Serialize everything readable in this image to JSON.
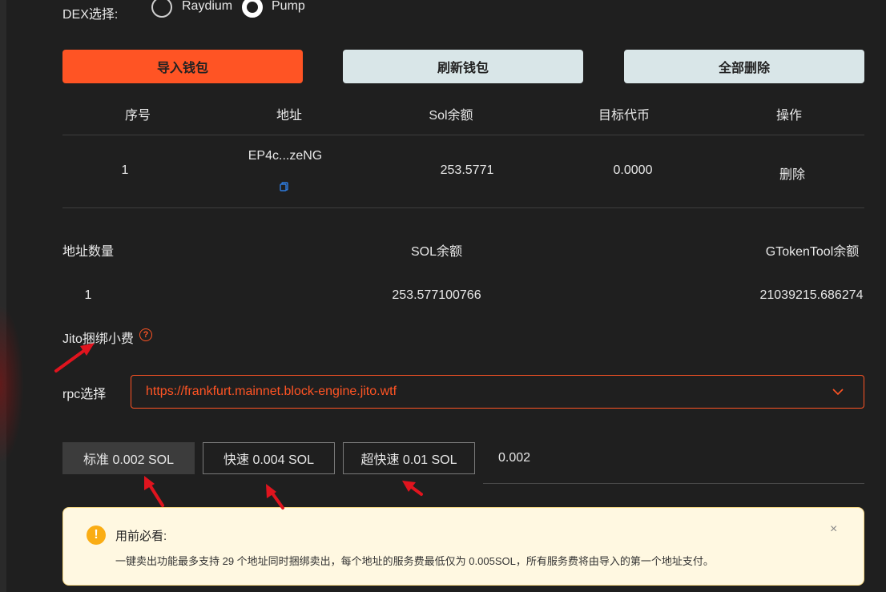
{
  "dex": {
    "label": "DEX选择:",
    "options": [
      {
        "label": "Raydium",
        "checked": false
      },
      {
        "label": "Pump",
        "checked": true
      }
    ]
  },
  "buttons": {
    "import": "导入钱包",
    "refresh": "刷新钱包",
    "delete_all": "全部删除"
  },
  "wallet_table": {
    "headers": [
      "序号",
      "地址",
      "Sol余额",
      "目标代币",
      "操作"
    ],
    "rows": [
      {
        "index": "1",
        "address": "EP4c...zeNG",
        "sol": "253.5771",
        "target": "0.0000",
        "action": "删除"
      }
    ]
  },
  "summary": {
    "headers": [
      "地址数量",
      "SOL余额",
      "GTokenTool余额"
    ],
    "values": [
      "1",
      "253.577100766",
      "21039215.686274"
    ]
  },
  "jito": {
    "label": "Jito捆绑小费",
    "help": "?"
  },
  "rpc": {
    "label": "rpc选择",
    "selected": "https://frankfurt.mainnet.block-engine.jito.wtf"
  },
  "fees": {
    "options": [
      "标准 0.002 SOL",
      "快速 0.004 SOL",
      "超快速 0.01 SOL"
    ],
    "active_index": 0,
    "value": "0.002"
  },
  "notice": {
    "title": "用前必看:",
    "text": "一键卖出功能最多支持 29 个地址同时捆绑卖出，每个地址的服务费最低仅为 0.005SOL，所有服务费将由导入的第一个地址支付。",
    "close": "×",
    "icon": "!"
  },
  "colors": {
    "accent": "#ff5424",
    "background": "#1f1f1f",
    "light_button": "#d9e6e8",
    "arrow": "#e0141e"
  }
}
